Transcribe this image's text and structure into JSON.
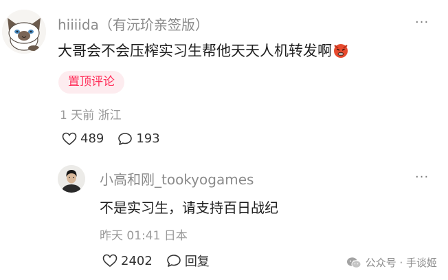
{
  "comment": {
    "username": "hiiiida",
    "user_note": "（有沅玠亲签版）",
    "text": "大哥会不会压榨实习生帮他天天人机转发啊",
    "emoji_icon": "angry-face-icon",
    "pinned_label": "置顶评论",
    "time_location": "1 天前 浙江",
    "likes": "489",
    "replies": "193",
    "more_label": "···"
  },
  "reply": {
    "username": "小高和刚_tookyogames",
    "text": "不是实习生，请支持百日战纪",
    "time_location": "昨天 01:41 日本",
    "likes": "2402",
    "reply_label": "回复",
    "more_label": "···"
  },
  "watermark": {
    "text": "公众号 · 手谈姬",
    "icon": "wechat-icon"
  },
  "colors": {
    "pinned_bg": "#fdecef",
    "pinned_text": "#ff2f5a",
    "meta": "#9a9a9a",
    "name": "#8a8a8a"
  }
}
